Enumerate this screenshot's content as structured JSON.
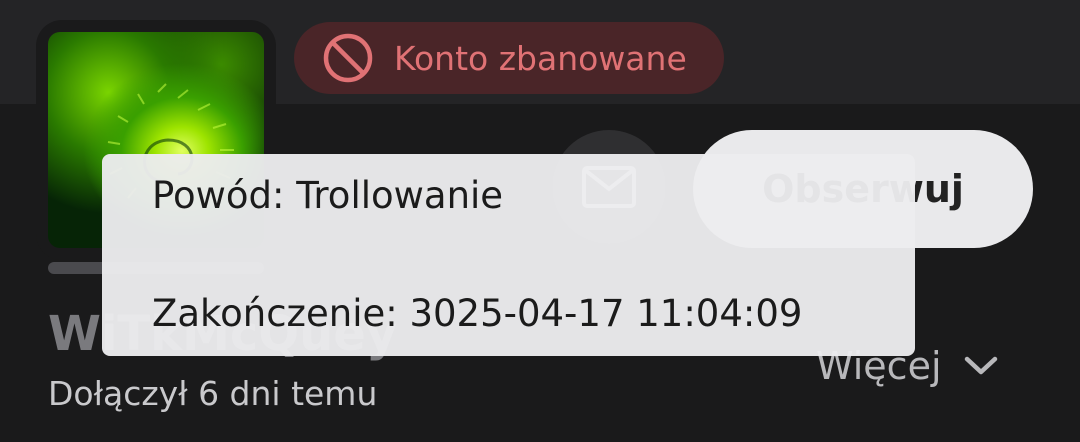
{
  "profile": {
    "ban_badge": {
      "label": "Konto zbanowane",
      "icon": "ban-icon",
      "color": "#e07275"
    },
    "username": "WiTkMcQuey",
    "joined": "Dołączył 6 dni temu",
    "follow_label": "Obserwuj",
    "message_icon": "mail-icon",
    "more_label": "Więcej",
    "more_icon": "chevron-down-icon"
  },
  "tooltip": {
    "reason": "Powód: Trollowanie",
    "ends": "Zakończenie: 3025-04-17 11:04:09"
  }
}
